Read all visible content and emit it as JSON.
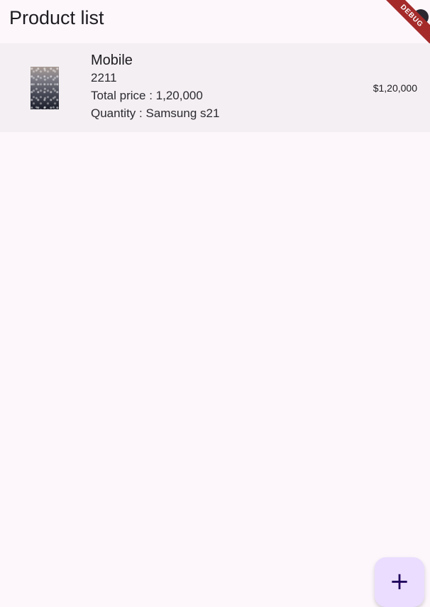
{
  "app_bar": {
    "title": "Product list",
    "action_icon": "account-circle-icon"
  },
  "debug_banner": {
    "label": "DEBUG",
    "color": "#a52b2b"
  },
  "products": [
    {
      "name": "Mobile",
      "code": "2211",
      "total_price_text": "Total price : 1,20,000",
      "quantity_text": "Quantity : Samsung s21",
      "price": "$1,20,000",
      "image_icon": "product-photo"
    }
  ],
  "fab": {
    "label": "+",
    "icon": "plus-icon",
    "color": "#eaddff"
  },
  "theme": {
    "background": "#fdf7fc",
    "list_item_background": "#f3eff2"
  }
}
